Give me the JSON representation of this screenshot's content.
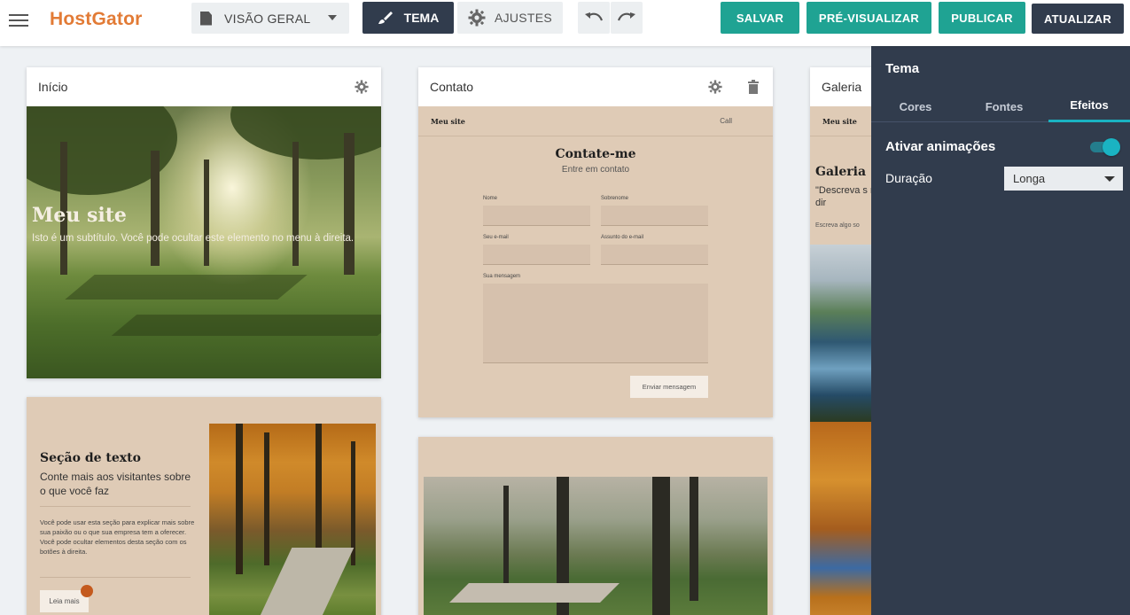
{
  "brand": {
    "logo_text": "HostGator",
    "accent": "#e27b36"
  },
  "toolbar": {
    "page_select": "VISÃO GERAL",
    "tema_label": "TEMA",
    "ajustes_label": "AJUSTES",
    "salvar_label": "SALVAR",
    "previsualizar_label": "PRÉ-VISUALIZAR",
    "publicar_label": "PUBLICAR",
    "atualizar_label": "ATUALIZAR",
    "primary_color": "#1fa393",
    "dark_color": "#313c4d"
  },
  "cards": {
    "inicio": {
      "title": "Início",
      "hero_title": "Meu site",
      "hero_subtitle": "Isto é um subtítulo. Você pode ocultar este elemento no menu à direita."
    },
    "secao": {
      "title": "Seção de texto",
      "lead": "Conte mais aos visitantes sobre o que você faz",
      "body": "Você pode usar esta seção para explicar mais sobre sua paixão ou o que sua empresa tem a oferecer. Você pode ocultar elementos desta seção com os botões à direita.",
      "button": "Leia mais"
    },
    "contato": {
      "title": "Contato",
      "mini_brand": "Meu site",
      "mini_link": "Call",
      "heading": "Contate-me",
      "subheading": "Entre em contato",
      "fields": {
        "nome": "Nome",
        "sobrenome": "Sobrenome",
        "email": "Seu e-mail",
        "assunto": "Assunto do e-mail",
        "mensagem": "Sua mensagem"
      },
      "send_button": "Enviar mensagem"
    },
    "galeria": {
      "title": "Galeria",
      "mini_brand": "Meu site",
      "heading": "Galeria",
      "quote": "\"Descreva s menu à dir",
      "small": "Escreva algo so"
    }
  },
  "panel": {
    "title": "Tema",
    "tabs": [
      "Cores",
      "Fontes",
      "Efeitos"
    ],
    "active_tab": "Efeitos",
    "animations_label": "Ativar animações",
    "animations_on": true,
    "duration_label": "Duração",
    "duration_value": "Longa",
    "accent": "#1ab3c2"
  }
}
